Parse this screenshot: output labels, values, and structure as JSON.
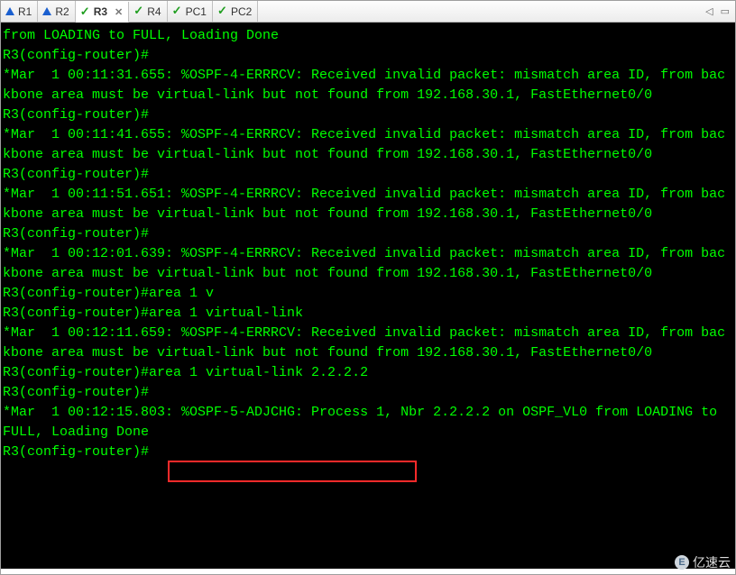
{
  "tabs": [
    {
      "label": "R1",
      "icon": "warn",
      "active": false
    },
    {
      "label": "R2",
      "icon": "warn",
      "active": false
    },
    {
      "label": "R3",
      "icon": "ok",
      "active": true
    },
    {
      "label": "R4",
      "icon": "ok",
      "active": false
    },
    {
      "label": "PC1",
      "icon": "ok",
      "active": false
    },
    {
      "label": "PC2",
      "icon": "ok",
      "active": false
    }
  ],
  "right_controls": {
    "left_arrow": "◁",
    "menu": "▭"
  },
  "prompt": "R3(config-router)#",
  "highlighted_command": "area 1 virtual-link 2.2.2.2",
  "terminal_lines": [
    "from LOADING to FULL, Loading Done",
    "R3(config-router)#",
    "*Mar  1 00:11:31.655: %OSPF-4-ERRRCV: Received invalid packet: mismatch area ID, from backbone area must be virtual-link but not found from 192.168.30.1, FastEthernet0/0",
    "R3(config-router)#",
    "*Mar  1 00:11:41.655: %OSPF-4-ERRRCV: Received invalid packet: mismatch area ID, from backbone area must be virtual-link but not found from 192.168.30.1, FastEthernet0/0",
    "R3(config-router)#",
    "*Mar  1 00:11:51.651: %OSPF-4-ERRRCV: Received invalid packet: mismatch area ID, from backbone area must be virtual-link but not found from 192.168.30.1, FastEthernet0/0",
    "R3(config-router)#",
    "*Mar  1 00:12:01.639: %OSPF-4-ERRRCV: Received invalid packet: mismatch area ID, from backbone area must be virtual-link but not found from 192.168.30.1, FastEthernet0/0",
    "R3(config-router)#area 1 v",
    "R3(config-router)#area 1 virtual-link",
    "*Mar  1 00:12:11.659: %OSPF-4-ERRRCV: Received invalid packet: mismatch area ID, from backbone area must be virtual-link but not found from 192.168.30.1, FastEthernet0/0",
    "R3(config-router)#area 1 virtual-link 2.2.2.2",
    "R3(config-router)#",
    "*Mar  1 00:12:15.803: %OSPF-5-ADJCHG: Process 1, Nbr 2.2.2.2 on OSPF_VL0 from LOADING to FULL, Loading Done",
    "R3(config-router)#"
  ],
  "watermark": {
    "badge": "E",
    "text": "亿速云"
  }
}
